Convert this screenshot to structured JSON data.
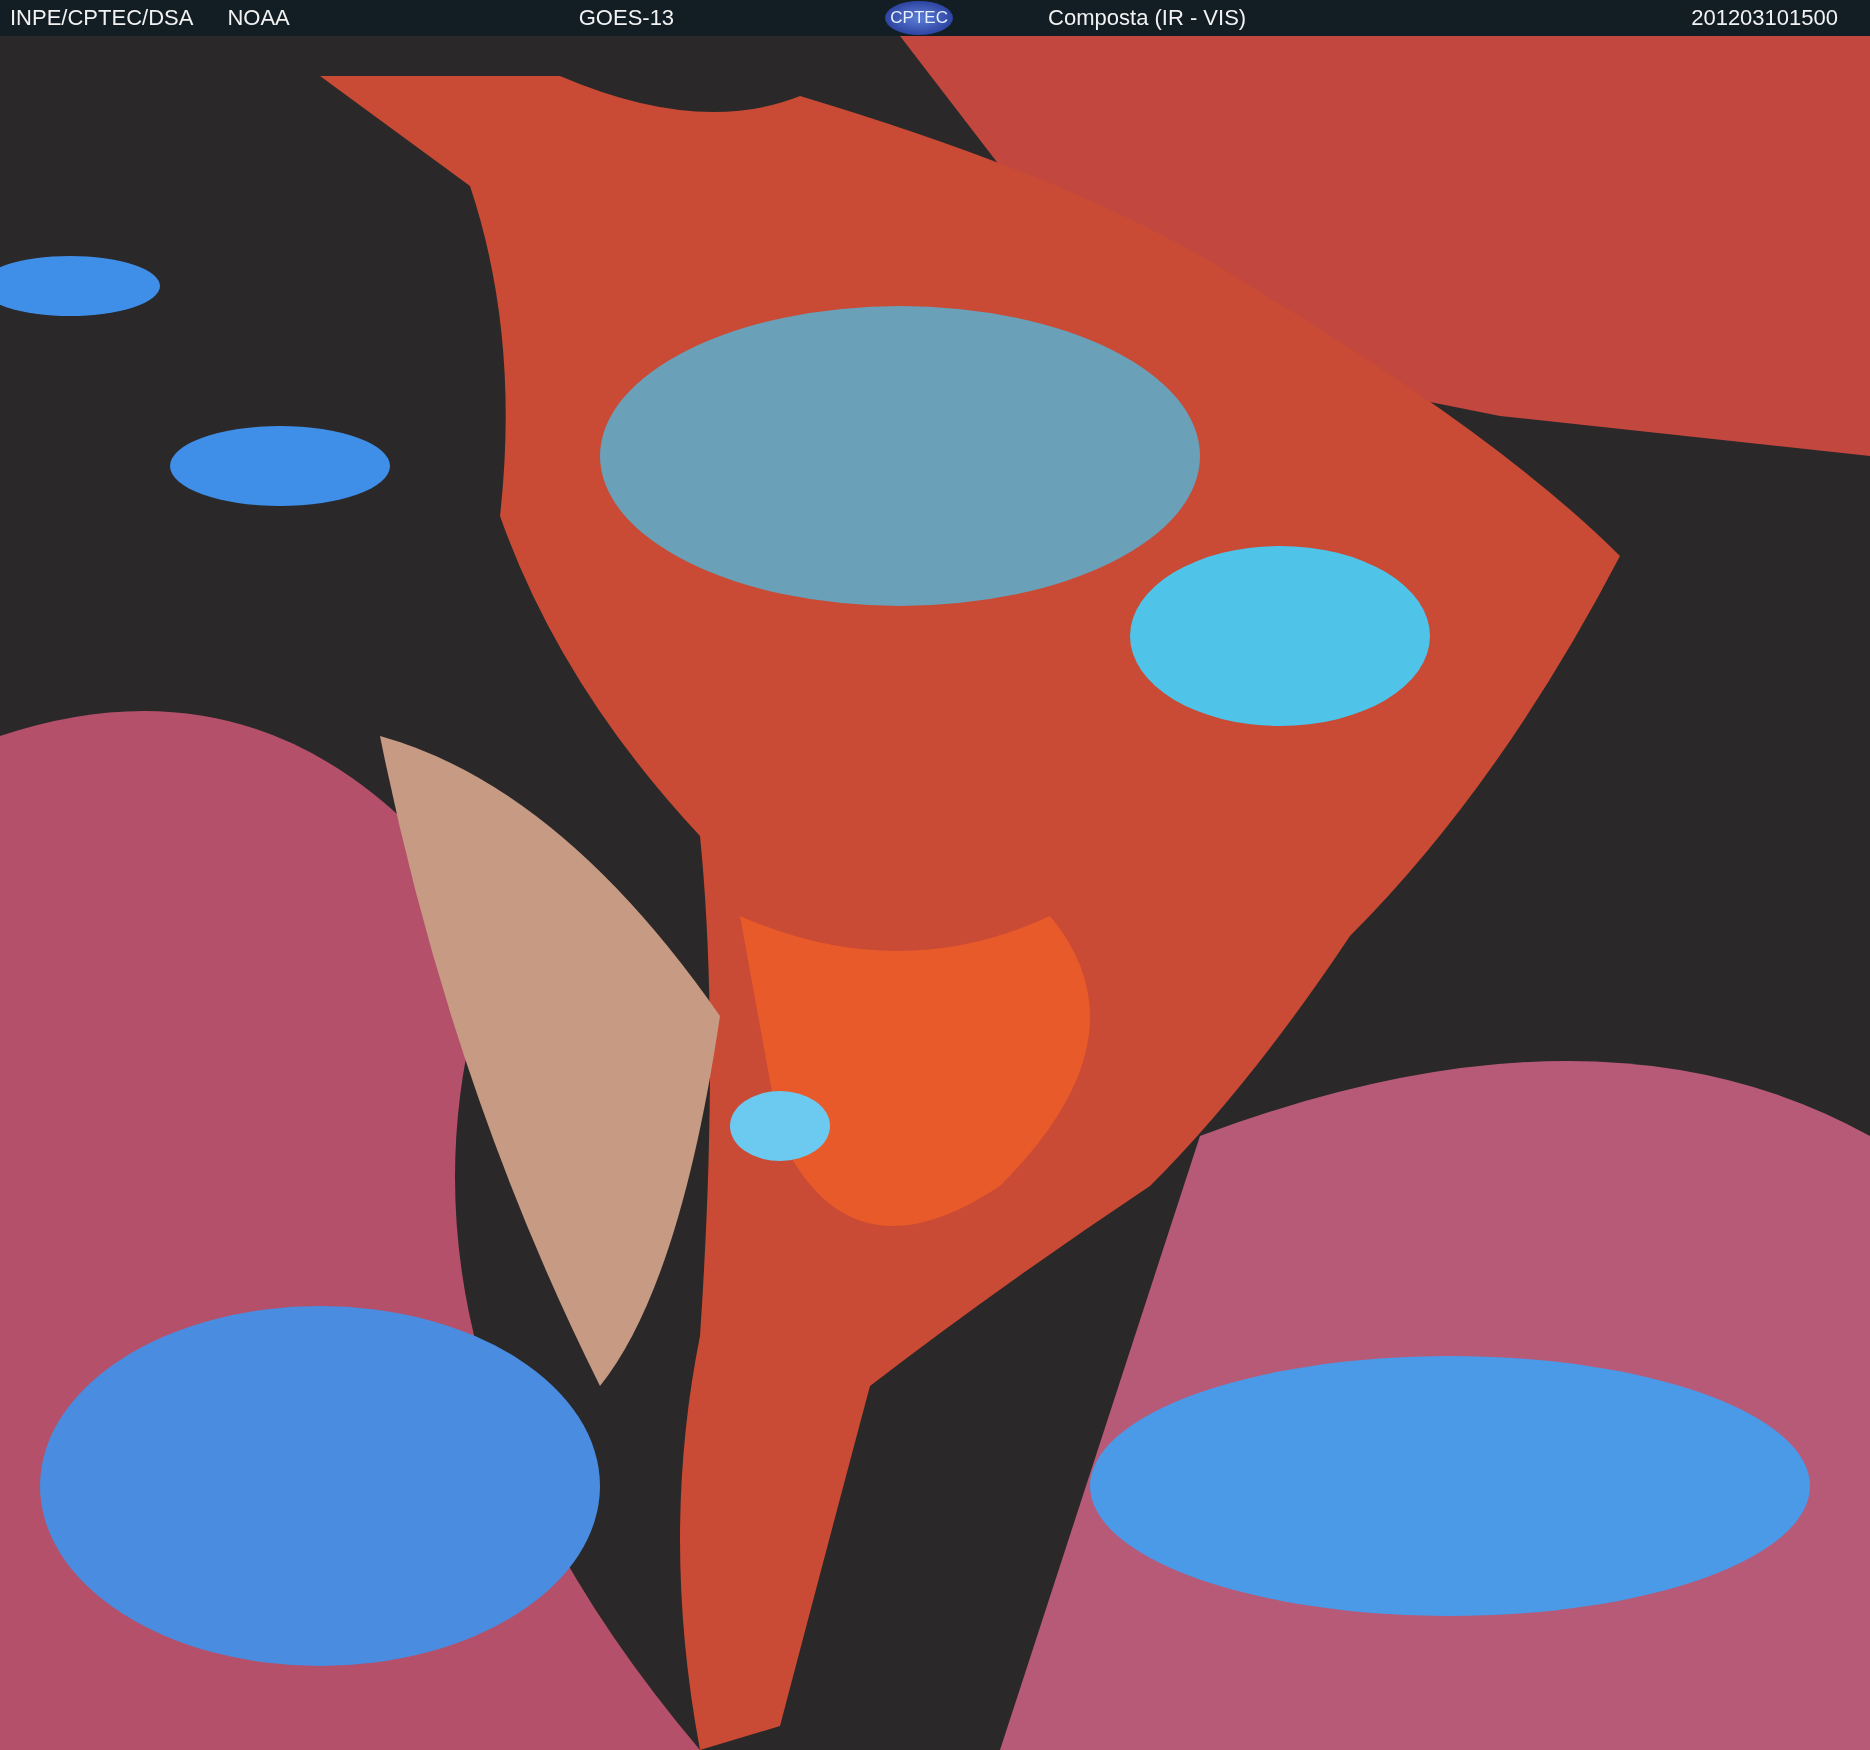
{
  "header": {
    "source": "INPE/CPTEC/DSA",
    "agency": "NOAA",
    "satellite": "GOES-13",
    "logo": "CPTEC",
    "product": "Composta (IR - VIS)",
    "timestamp": "201203101500"
  }
}
